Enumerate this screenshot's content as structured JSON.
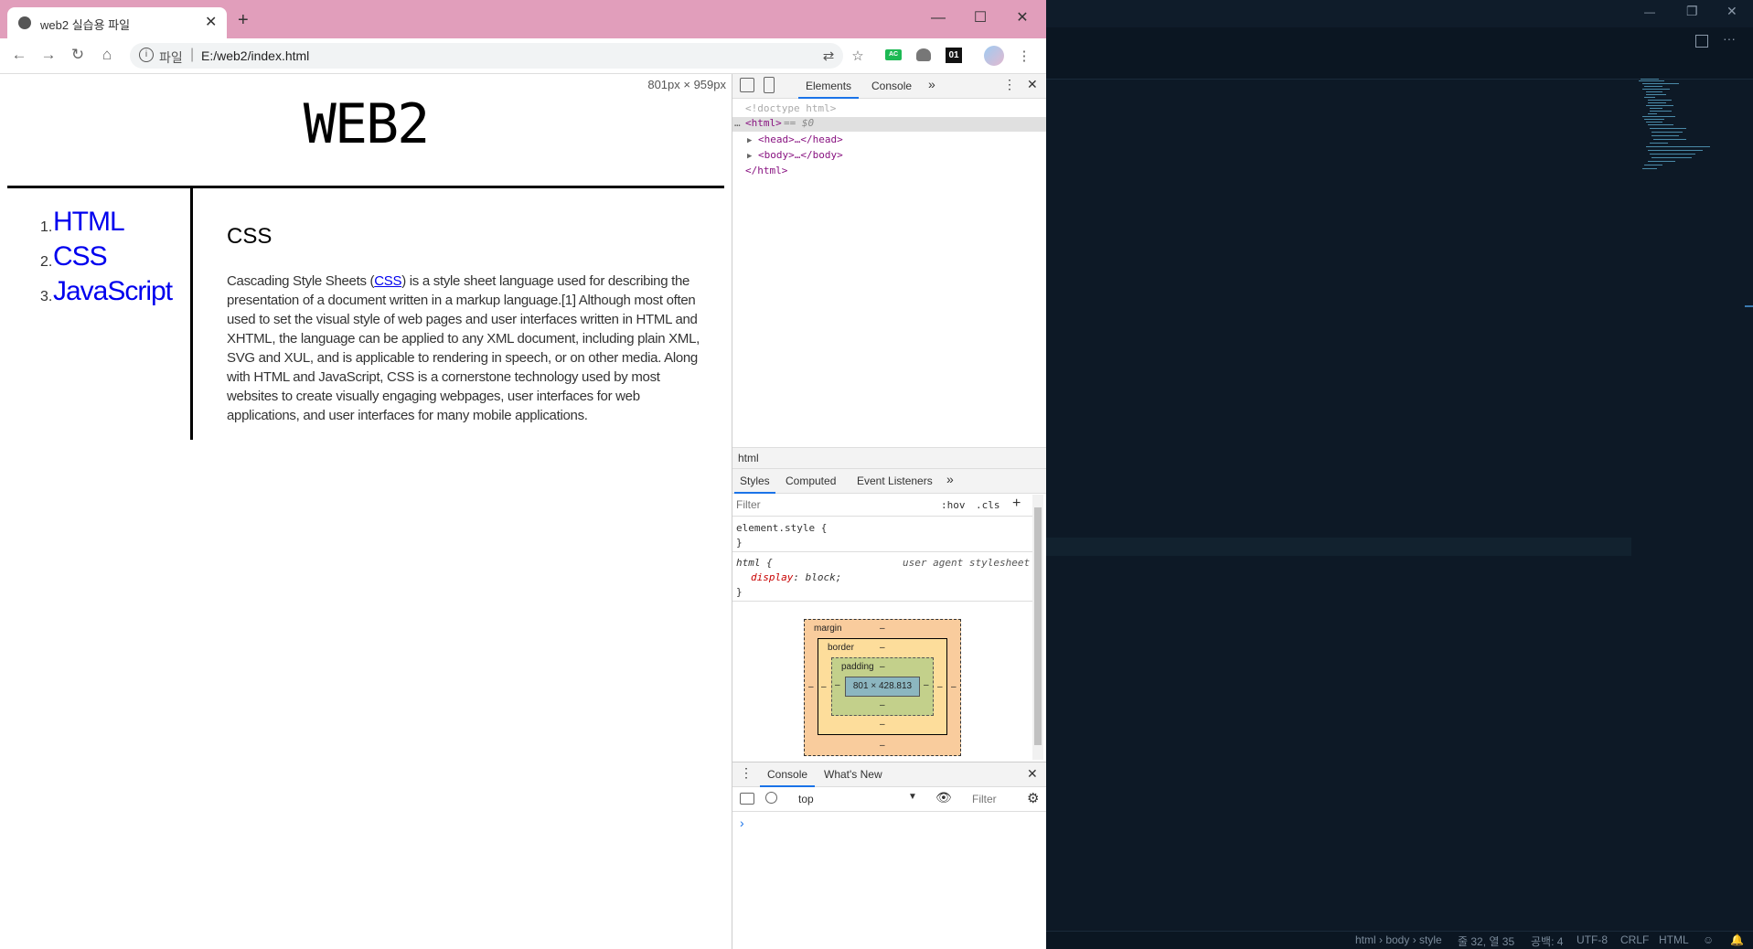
{
  "chrome": {
    "tab_title": "web2 실습용 파일",
    "new_tab": "+",
    "tab_close": "✕",
    "win_minimize": "—",
    "win_maximize": "☐",
    "win_close": "✕",
    "url_scheme": "파일",
    "url_sep": "|",
    "url": "E:/web2/index.html",
    "ext_ac": "AC",
    "ext_01": "01"
  },
  "page": {
    "dimensions": "801px × 959px",
    "site_title": "WEB2",
    "nav": [
      {
        "num": "1.",
        "label": "HTML"
      },
      {
        "num": "2.",
        "label": "CSS"
      },
      {
        "num": "3.",
        "label": "JavaScript"
      }
    ],
    "article_title": "CSS",
    "article_pre": "Cascading Style Sheets (",
    "article_link": "CSS",
    "article_post": ") is a style sheet language used for describing the presentation of a document written in a markup language.[1] Although most often used to set the visual style of web pages and user interfaces written in HTML and XHTML, the language can be applied to any XML document, including plain XML, SVG and XUL, and is applicable to rendering in speech, or on other media. Along with HTML and JavaScript, CSS is a cornerstone technology used by most websites to create visually engaging webpages, user interfaces for web applications, and user interfaces for many mobile applications."
  },
  "devtools": {
    "tabs": [
      "Elements",
      "Console"
    ],
    "more": "»",
    "dom": {
      "doctype": "<!doctype html>",
      "html_open": "<html>",
      "html_eq": " == $0",
      "head": "<head>…</head>",
      "body": "<body>…</body>",
      "html_close": "</html>"
    },
    "breadcrumb": "html",
    "style_tabs": [
      "Styles",
      "Computed",
      "Event Listeners"
    ],
    "filter_placeholder": "Filter",
    "hov": ":hov",
    "cls": ".cls",
    "plus": "+",
    "element_style_open": "element.style {",
    "brace_close": "}",
    "html_rule": "html {",
    "ua_label": "user agent stylesheet",
    "prop_name": "display",
    "prop_value": "block;",
    "box": {
      "margin": "margin",
      "border": "border",
      "padding": "padding",
      "dash": "–",
      "content": "801 × 428.813"
    },
    "drawer_tabs": [
      "Console",
      "What's New"
    ],
    "context": "top",
    "console_filter": "Filter",
    "prompt": "›"
  },
  "vscode": {
    "status": {
      "breadcrumb": "html › body › style",
      "position": "줄 32, 열 35",
      "spaces": "공백: 4",
      "encoding": "UTF-8",
      "eol": "CRLF",
      "language": "HTML"
    },
    "win_minimize": "—",
    "win_restore": "❐",
    "win_close": "✕",
    "more": "···"
  }
}
